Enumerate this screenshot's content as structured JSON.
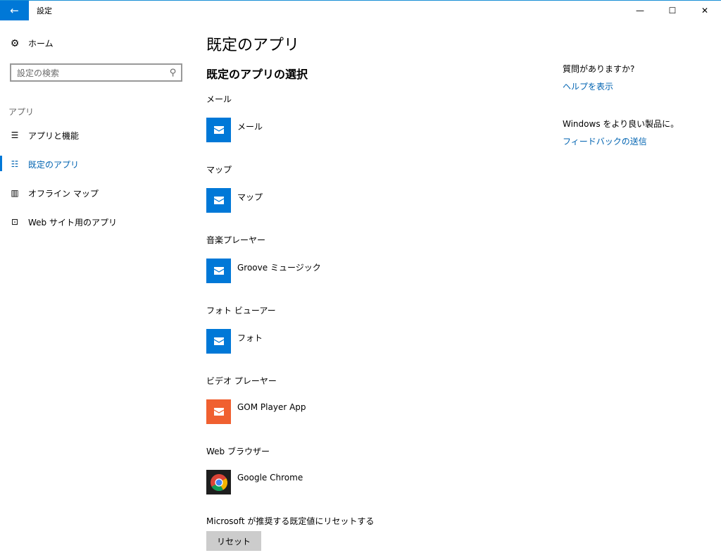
{
  "window": {
    "title": "設定",
    "back_icon": "←",
    "minimize_icon": "—",
    "maximize_icon": "☐",
    "close_icon": "✕"
  },
  "sidebar": {
    "home": {
      "label": "ホーム",
      "icon": "gear-icon"
    },
    "search": {
      "placeholder": "設定の検索"
    },
    "section_label": "アプリ",
    "items": [
      {
        "label": "アプリと機能",
        "icon": "list-icon",
        "active": false
      },
      {
        "label": "既定のアプリ",
        "icon": "default-list-icon",
        "active": true
      },
      {
        "label": "オフライン マップ",
        "icon": "map-icon",
        "active": false
      },
      {
        "label": "Web サイト用のアプリ",
        "icon": "web-app-icon",
        "active": false
      }
    ]
  },
  "main": {
    "title": "既定のアプリ",
    "subtitle": "既定のアプリの選択",
    "categories": [
      {
        "label": "メール",
        "app": "メール",
        "tile_color": "#0078d7",
        "icon": "mail-app-icon"
      },
      {
        "label": "マップ",
        "app": "マップ",
        "tile_color": "#0078d7",
        "icon": "maps-app-icon"
      },
      {
        "label": "音楽プレーヤー",
        "app": "Groove ミュージック",
        "tile_color": "#0078d7",
        "icon": "groove-app-icon"
      },
      {
        "label": "フォト ビューアー",
        "app": "フォト",
        "tile_color": "#0078d7",
        "icon": "photos-app-icon"
      },
      {
        "label": "ビデオ プレーヤー",
        "app": "GOM Player App",
        "tile_color": "#f06030",
        "icon": "gom-player-app-icon"
      },
      {
        "label": "Web ブラウザー",
        "app": "Google Chrome",
        "tile_color": "#1e1e1e",
        "icon": "chrome-icon"
      }
    ],
    "reset_label": "Microsoft が推奨する既定値にリセットする",
    "reset_button": "リセット"
  },
  "right_panel": {
    "question": "質問がありますか?",
    "help_link": "ヘルプを表示",
    "feedback_prompt": "Windows をより良い製品に。",
    "feedback_link": "フィードバックの送信"
  }
}
